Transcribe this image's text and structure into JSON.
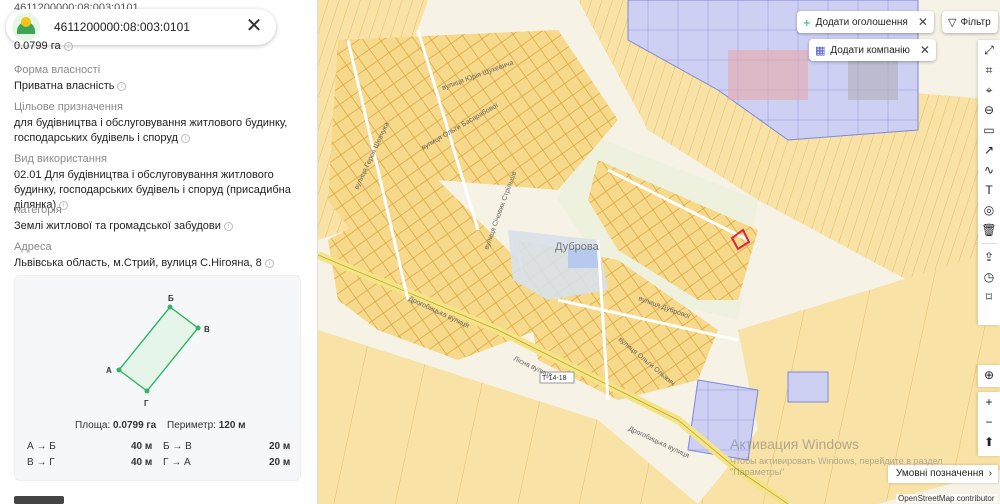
{
  "panel": {
    "top_ghost": "4611200000:08:003:0101",
    "cadastral_number": "4611200000:08:003:0101",
    "area_top": "0.0799 га",
    "fields": [
      {
        "label": "Форма власності",
        "value": "Приватна власність"
      },
      {
        "label": "Цільове призначення",
        "value": "для будівництва і обслуговування житлового будинку, господарських будівель і споруд"
      },
      {
        "label": "Вид використання",
        "value": "02.01 Для будівництва і обслуговування житлового будинку, господарських будівель і споруд (присадибна ділянка)"
      },
      {
        "label": "Категорія",
        "value": "Землі житлової та громадської забудови"
      },
      {
        "label": "Адреса",
        "value": "Львівська область, м.Стрий, вулиця С.Нігояна, 8"
      }
    ],
    "plot": {
      "vertices": {
        "a": "А",
        "b": "Б",
        "v": "В",
        "g": "Г"
      },
      "area_label": "Площа:",
      "area_value": "0.0799 га",
      "perimeter_label": "Периметр:",
      "perimeter_value": "120 м",
      "sides": [
        {
          "name": "А → Б",
          "length": "40 м"
        },
        {
          "name": "Б → В",
          "length": "20 м"
        },
        {
          "name": "В → Г",
          "length": "40 м"
        },
        {
          "name": "Г → А",
          "length": "20 м"
        }
      ]
    }
  },
  "map": {
    "chip_add_listing": "Додати оголошення",
    "chip_add_company": "Додати компанію",
    "filter_label": "Фільтр",
    "village_label": "Дуброва",
    "road_badge": "Т-14-18",
    "streets": [
      "Дрогобицька вулиця",
      "Дрогобицька вулиця",
      "вулиця Юрія Шухевича",
      "вулиця Ольги Басарабової",
      "вулиця Героя Шевчука",
      "вулиця Січових Стрільців",
      "вулиця Дубрової",
      "вулиця Ольги Ольжич",
      "Лісна вулиця"
    ],
    "legend_label": "Умовні позначення",
    "attribution": "OpenStreetMap contributor",
    "watermark_title": "Активация Windows",
    "watermark_text": "Чтобы активировать Windows, перейдите в раздел \"Параметры\"",
    "colors": {
      "parcel": "#f6d98a",
      "parcel_stroke": "#d9a23a",
      "industrial": "#c9cbf2",
      "selected": "#d7263d",
      "road": "#f2e487"
    }
  }
}
